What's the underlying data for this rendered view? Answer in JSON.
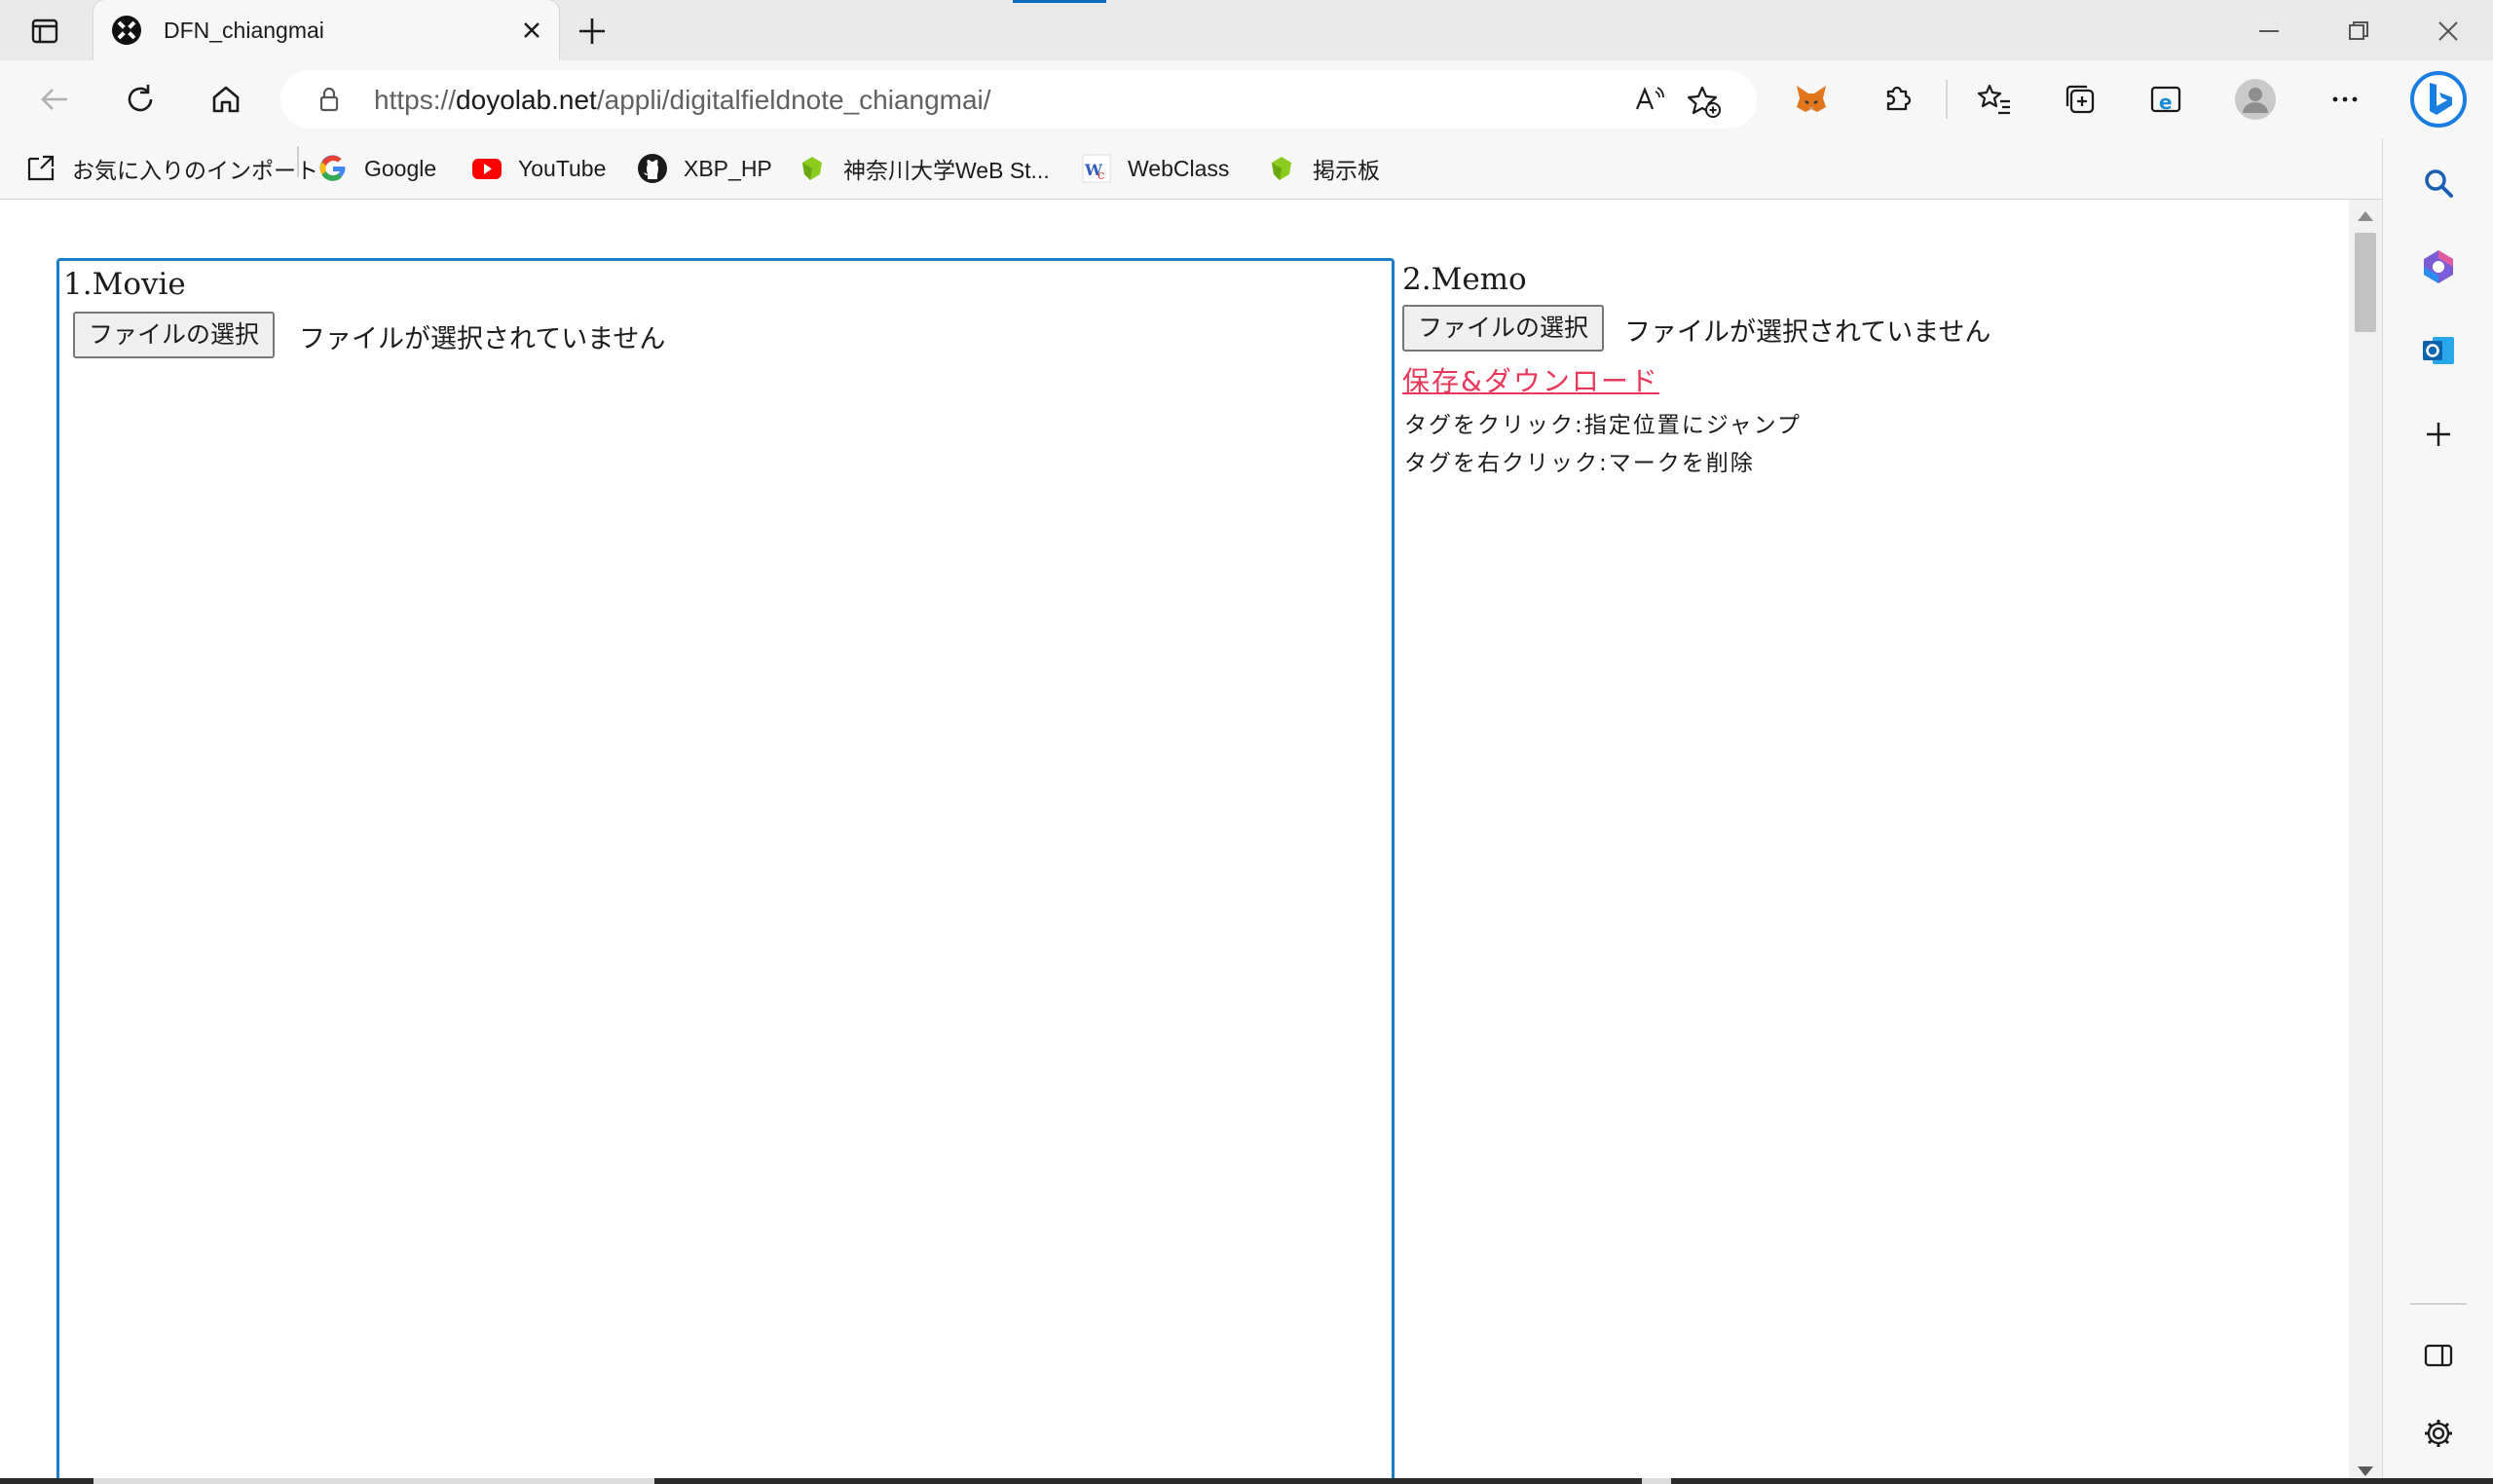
{
  "browser": {
    "tab": {
      "title": "DFN_chiangmai"
    },
    "address": {
      "scheme": "https://",
      "host": "doyolab.net",
      "path": "/appli/digitalfieldnote_chiangmai/"
    },
    "bookmarks": [
      {
        "label": "お気に入りのインポート",
        "icon": "import-favorites-icon"
      },
      {
        "label": "Google",
        "icon": "google-icon"
      },
      {
        "label": "YouTube",
        "icon": "youtube-icon"
      },
      {
        "label": "XBP_HP",
        "icon": "github-icon"
      },
      {
        "label": "神奈川大学WeB St...",
        "icon": "leaf-icon"
      },
      {
        "label": "WebClass",
        "icon": "webclass-icon"
      },
      {
        "label": "掲示板",
        "icon": "leaf-icon"
      }
    ],
    "colors": {
      "accent": "#0f6cbd",
      "panel_border": "#1a7dc6",
      "link": "#e8375a"
    }
  },
  "page": {
    "movie": {
      "title": "1.Movie",
      "file_button": "ファイルの選択",
      "file_status": "ファイルが選択されていません"
    },
    "memo": {
      "title": "2.Memo",
      "file_button": "ファイルの選択",
      "file_status": "ファイルが選択されていません",
      "save_link": "保存&ダウンロード",
      "hint_jump": "タグをクリック:指定位置にジャンプ",
      "hint_delete": "タグを右クリック:マークを削除"
    }
  }
}
